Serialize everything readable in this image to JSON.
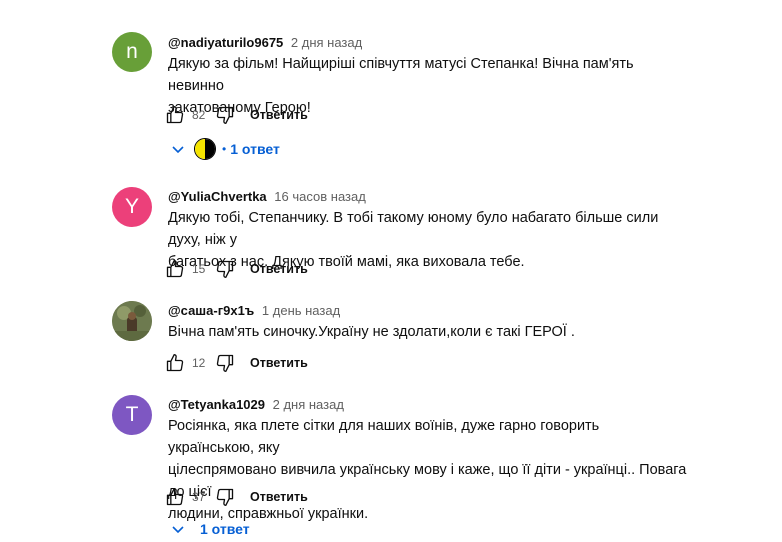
{
  "comments": [
    {
      "author": "@nadiyaturilo9675",
      "time": "2 дня назад",
      "avatar_letter": "n",
      "avatar_color": "#689f38",
      "lines": [
        "Дякую за фільм! Найщиріші співчуття матусі Степанка! Вічна пам'ять невинно",
        "закатованому Герою!"
      ],
      "likes": "82",
      "reply_label": "Ответить",
      "replies_label": "1 ответ",
      "reply_avatar_colors": [
        "#f5e400",
        "#000000"
      ]
    },
    {
      "author": "@YuliaChvertka",
      "time": "16 часов назад",
      "avatar_letter": "Y",
      "avatar_color": "#ec407a",
      "lines": [
        "Дякую тобі, Степанчику. В тобі такому юному було набагато більше сили духу, ніж у",
        "багатьох з нас. Дякую твоїй мамі, яка виховала тебе."
      ],
      "likes": "15",
      "reply_label": "Ответить"
    },
    {
      "author": "@саша-г9х1ъ",
      "time": "1 день назад",
      "avatar_color": "#6d7a4f",
      "lines": [
        "Вічна пам'ять синочку.Україну не здолати,коли є такі ГЕРОЇ ."
      ],
      "likes": "12",
      "reply_label": "Ответить"
    },
    {
      "author": "@Tetyanka1029",
      "time": "2 дня назад",
      "avatar_letter": "T",
      "avatar_color": "#7e57c2",
      "lines": [
        "Росіянка, яка плете сітки для наших воїнів, дуже гарно говорить українською, яку",
        "цілеспрямовано вивчила українську мову і каже, що її діти - українці.. Повага до цієї",
        "людини, справжньої українки."
      ],
      "likes": "37",
      "reply_label": "Ответить",
      "replies_label": "1 ответ"
    }
  ]
}
